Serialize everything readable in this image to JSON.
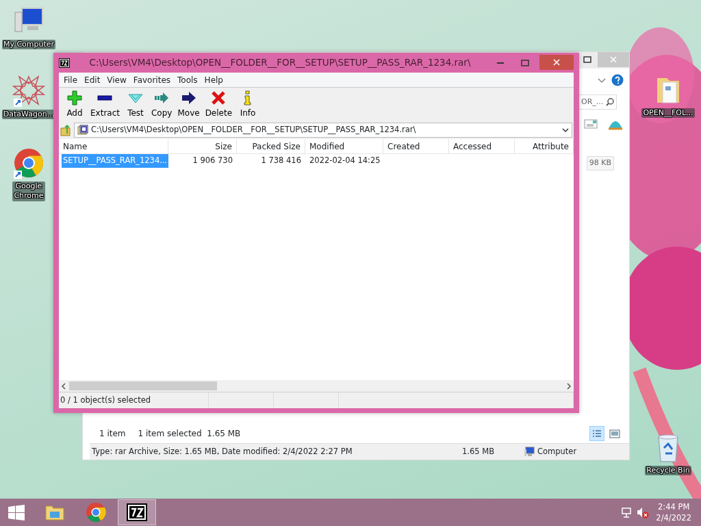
{
  "desktop_icons": [
    {
      "label": "My Computer",
      "kind": "computer"
    },
    {
      "label": "DataWagon...",
      "kind": "star-shortcut"
    },
    {
      "label": "Google\nChrome",
      "kind": "chrome-shortcut"
    },
    {
      "label": "OPEN__FOL...",
      "kind": "folder"
    },
    {
      "label": "Recycle Bin",
      "kind": "recycle"
    }
  ],
  "explorer_window": {
    "search_placeholder": "OR_...",
    "size_tag": "98 KB",
    "item_count": "1 item",
    "selection_info": "1 item selected  1.65 MB",
    "views": [
      {
        "kind": "details",
        "selected": true
      },
      {
        "kind": "preview",
        "selected": false
      }
    ],
    "status_bar": {
      "type_info": "Type: rar Archive, Size: 1.65 MB, Date modified: 2/4/2022 2:27 PM",
      "size": "1.65 MB",
      "location": "Computer"
    }
  },
  "sevenzip_window": {
    "title": "C:\\Users\\VM4\\Desktop\\OPEN__FOLDER__FOR__SETUP\\SETUP__PASS_RAR_1234.rar\\",
    "menu": [
      "File",
      "Edit",
      "View",
      "Favorites",
      "Tools",
      "Help"
    ],
    "toolbar": [
      {
        "label": "Add",
        "kind": "add"
      },
      {
        "label": "Extract",
        "kind": "extract"
      },
      {
        "label": "Test",
        "kind": "test"
      },
      {
        "label": "Copy",
        "kind": "copy"
      },
      {
        "label": "Move",
        "kind": "move"
      },
      {
        "label": "Delete",
        "kind": "delete"
      },
      {
        "label": "Info",
        "kind": "info"
      }
    ],
    "address": "C:\\Users\\VM4\\Desktop\\OPEN__FOLDER__FOR__SETUP\\SETUP__PASS_RAR_1234.rar\\",
    "columns": [
      "Name",
      "Size",
      "Packed Size",
      "Modified",
      "Created",
      "Accessed",
      "Attribute"
    ],
    "rows": [
      {
        "cells": [
          "SETUP__PASS_RAR_1234...",
          "1 906 730",
          "1 738 416",
          "2022-02-04 14:25",
          "",
          "",
          ""
        ],
        "selected": true
      }
    ],
    "status_bar": [
      "0 / 1 object(s) selected"
    ]
  },
  "taskbar": {
    "apps": [
      {
        "kind": "explorer",
        "selected": false
      },
      {
        "kind": "chrome",
        "selected": false
      },
      {
        "kind": "sevenzip",
        "selected": true
      }
    ],
    "time": "2:44 PM",
    "date": "2/4/2022"
  }
}
